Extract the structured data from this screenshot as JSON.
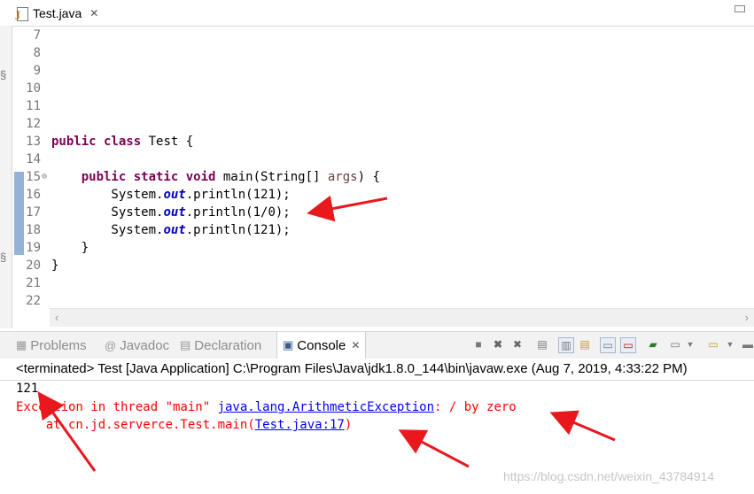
{
  "editor_tab": {
    "title": "Test.java",
    "close": "✕"
  },
  "code_lines": [
    {
      "num": "7",
      "html": ""
    },
    {
      "num": "8",
      "html": ""
    },
    {
      "num": "9",
      "html": ""
    },
    {
      "num": "10",
      "html": ""
    },
    {
      "num": "11",
      "html": ""
    },
    {
      "num": "12",
      "html": ""
    },
    {
      "num": "13",
      "html": "<span class=\"kw\">public class</span> Test {"
    },
    {
      "num": "14",
      "html": ""
    },
    {
      "num": "15",
      "html": "    <span class=\"kw\">public static void</span> main(String[] <span class=\"param\">args</span>) {"
    },
    {
      "num": "16",
      "html": "        System.<span class=\"fld\">out</span>.println(121);"
    },
    {
      "num": "17",
      "html": "        System.<span class=\"fld\">out</span>.println(1/0);"
    },
    {
      "num": "18",
      "html": "        System.<span class=\"fld\">out</span>.println(121);"
    },
    {
      "num": "19",
      "html": "    }"
    },
    {
      "num": "20",
      "html": "}"
    },
    {
      "num": "21",
      "html": ""
    },
    {
      "num": "22",
      "html": ""
    }
  ],
  "views": {
    "problems": "Problems",
    "javadoc": "Javadoc",
    "declaration": "Declaration",
    "console": "Console"
  },
  "console": {
    "terminated": "<terminated> Test [Java Application] C:\\Program Files\\Java\\jdk1.8.0_144\\bin\\javaw.exe (Aug 7, 2019, 4:33:22 PM)",
    "output": "121",
    "exception_prefix": "Exception in thread \"main\" ",
    "exception_class": "java.lang.ArithmeticException",
    "exception_message": ": / by zero",
    "stack_prefix": "    at cn.jd.serverce.Test.main(",
    "stack_link": "Test.java:17",
    "stack_suffix": ")"
  },
  "watermark": "https://blog.csdn.net/weixin_43784914",
  "colors": {
    "keyword": "#7f0055",
    "field": "#0000c0",
    "error": "#ff0000",
    "link": "#0000ff",
    "arrow": "#e8181d"
  }
}
